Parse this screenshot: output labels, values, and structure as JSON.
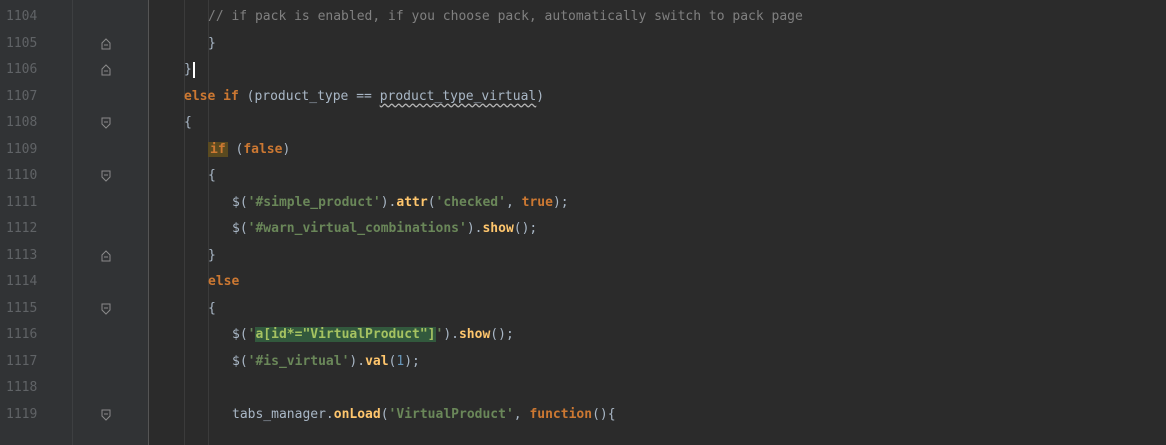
{
  "editor": {
    "lines": [
      {
        "number": "1104",
        "fold": "",
        "indent": 3,
        "tokens": [
          {
            "t": "// if pack is enabled, if you choose pack, automatically switch to pack page",
            "c": "cmt"
          }
        ]
      },
      {
        "number": "1105",
        "fold": "end",
        "indent": 3,
        "tokens": [
          {
            "t": "}",
            "c": "op"
          }
        ]
      },
      {
        "number": "1106",
        "fold": "end",
        "indent": 2,
        "tokens": [
          {
            "t": "}",
            "c": "op"
          }
        ]
      },
      {
        "number": "1107",
        "fold": "",
        "indent": 2,
        "tokens": [
          {
            "t": "else if",
            "c": "kw"
          },
          {
            "t": " (product_type == ",
            "c": "var"
          },
          {
            "t": "product_type_virtual",
            "c": "var underline-wavy"
          },
          {
            "t": ")",
            "c": "var"
          }
        ]
      },
      {
        "number": "1108",
        "fold": "start",
        "indent": 2,
        "tokens": [
          {
            "t": "{",
            "c": "op"
          }
        ]
      },
      {
        "number": "1109",
        "fold": "",
        "indent": 3,
        "tokens": [
          {
            "t": "if",
            "c": "hl-kw"
          },
          {
            "t": " (",
            "c": "var"
          },
          {
            "t": "false",
            "c": "kw"
          },
          {
            "t": ")",
            "c": "var"
          }
        ]
      },
      {
        "number": "1110",
        "fold": "start",
        "indent": 3,
        "tokens": [
          {
            "t": "{",
            "c": "op"
          }
        ]
      },
      {
        "number": "1111",
        "fold": "",
        "indent": 4,
        "tokens": [
          {
            "t": "$(",
            "c": "var"
          },
          {
            "t": "'#simple_product'",
            "c": "str"
          },
          {
            "t": ").",
            "c": "var"
          },
          {
            "t": "attr",
            "c": "fn"
          },
          {
            "t": "(",
            "c": "var"
          },
          {
            "t": "'checked'",
            "c": "str"
          },
          {
            "t": ", ",
            "c": "var"
          },
          {
            "t": "true",
            "c": "kw"
          },
          {
            "t": ");",
            "c": "var"
          }
        ]
      },
      {
        "number": "1112",
        "fold": "",
        "indent": 4,
        "tokens": [
          {
            "t": "$(",
            "c": "var"
          },
          {
            "t": "'#warn_virtual_combinations'",
            "c": "str"
          },
          {
            "t": ").",
            "c": "var"
          },
          {
            "t": "show",
            "c": "fn"
          },
          {
            "t": "();",
            "c": "var"
          }
        ]
      },
      {
        "number": "1113",
        "fold": "end",
        "indent": 3,
        "tokens": [
          {
            "t": "}",
            "c": "op"
          }
        ]
      },
      {
        "number": "1114",
        "fold": "",
        "indent": 3,
        "tokens": [
          {
            "t": "else",
            "c": "kw"
          }
        ]
      },
      {
        "number": "1115",
        "fold": "start",
        "indent": 3,
        "tokens": [
          {
            "t": "{",
            "c": "op"
          }
        ]
      },
      {
        "number": "1116",
        "fold": "",
        "indent": 4,
        "tokens": [
          {
            "t": "$(",
            "c": "var"
          },
          {
            "t": "'",
            "c": "str"
          },
          {
            "t": "a[id*=\"VirtualProduct\"]",
            "c": "hl-sel"
          },
          {
            "t": "'",
            "c": "str"
          },
          {
            "t": ").",
            "c": "var"
          },
          {
            "t": "show",
            "c": "fn"
          },
          {
            "t": "();",
            "c": "var"
          }
        ]
      },
      {
        "number": "1117",
        "fold": "",
        "indent": 4,
        "tokens": [
          {
            "t": "$(",
            "c": "var"
          },
          {
            "t": "'#is_virtual'",
            "c": "str"
          },
          {
            "t": ").",
            "c": "var"
          },
          {
            "t": "val",
            "c": "fn"
          },
          {
            "t": "(",
            "c": "var"
          },
          {
            "t": "1",
            "c": "num"
          },
          {
            "t": ");",
            "c": "var"
          }
        ]
      },
      {
        "number": "1118",
        "fold": "",
        "indent": 4,
        "tokens": []
      },
      {
        "number": "1119",
        "fold": "start",
        "indent": 4,
        "tokens": [
          {
            "t": "tabs_manager.",
            "c": "var"
          },
          {
            "t": "onLoad",
            "c": "fn"
          },
          {
            "t": "(",
            "c": "var"
          },
          {
            "t": "'VirtualProduct'",
            "c": "str"
          },
          {
            "t": ", ",
            "c": "var"
          },
          {
            "t": "function",
            "c": "kw"
          },
          {
            "t": "(){",
            "c": "var"
          }
        ]
      }
    ],
    "caret_line": "1106",
    "colors": {
      "background": "#2b2b2b",
      "gutter": "#313335",
      "line_number": "#606366",
      "keyword": "#cc7832",
      "string": "#6a8759",
      "comment": "#808080",
      "function": "#ffc66d",
      "number": "#6897bb"
    }
  }
}
